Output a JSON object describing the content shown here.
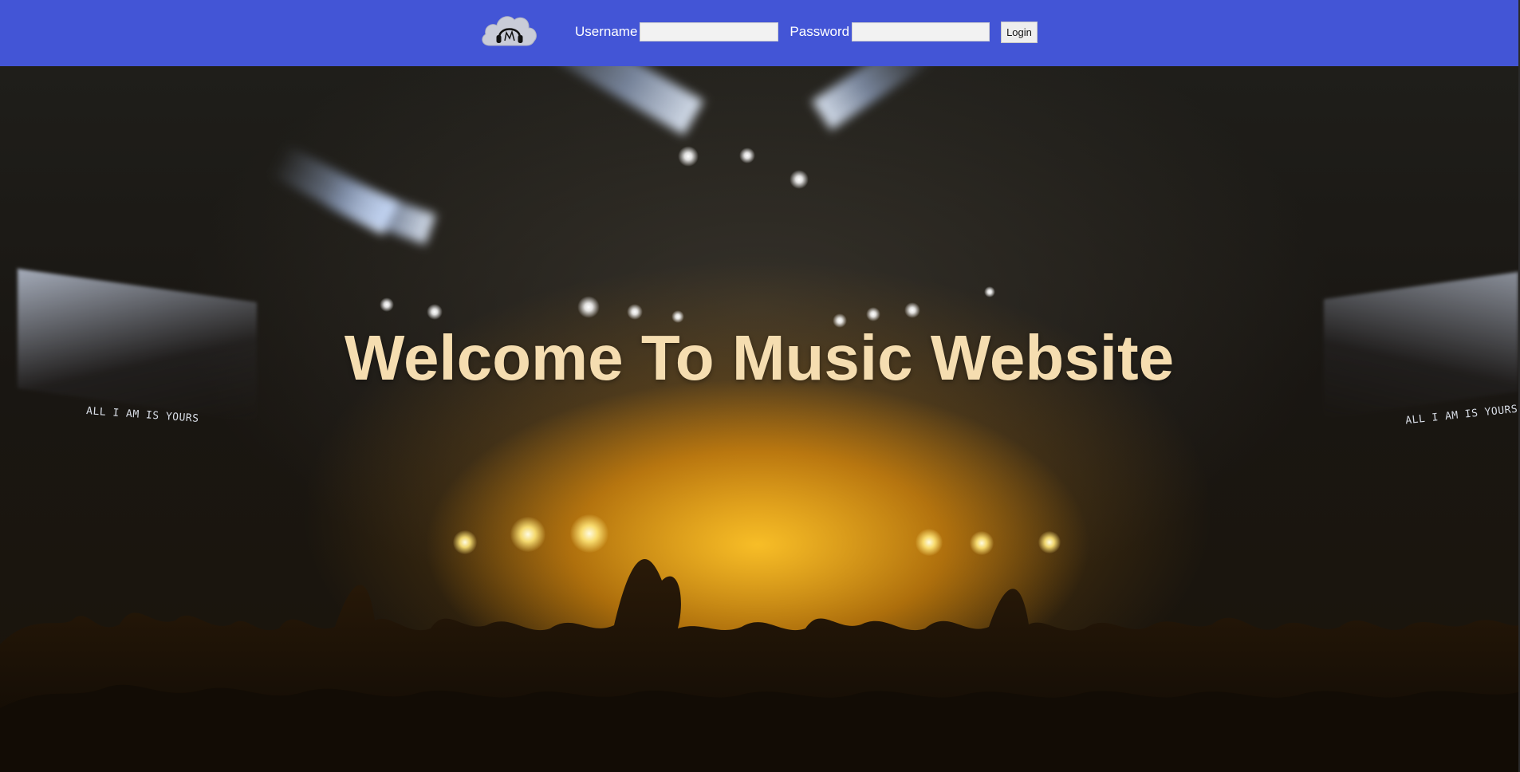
{
  "header": {
    "logo_icon": "cloud-headphones-icon",
    "username_label": "Username",
    "username_value": "",
    "password_label": "Password",
    "password_value": "",
    "login_label": "Login"
  },
  "hero": {
    "title": "Welcome To Music Website",
    "screen_text_left": "ALL I AM IS YOURS",
    "screen_text_right": "ALL I AM IS YOURS"
  },
  "colors": {
    "header_bg": "#4355d6",
    "title": "#f5ddb0",
    "stage_glow": "#ffc428"
  }
}
